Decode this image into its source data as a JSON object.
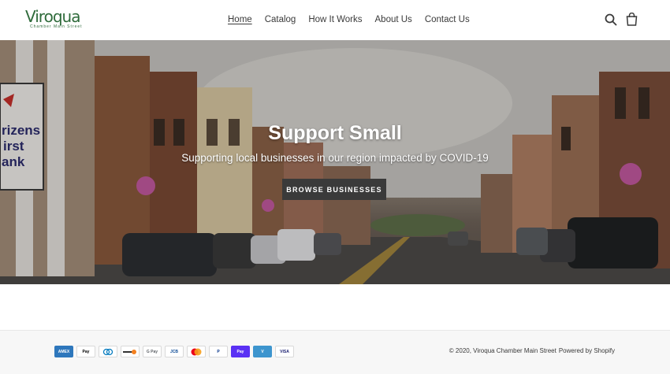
{
  "logo": {
    "name": "Viroqua",
    "tagline": "Chamber Main Street"
  },
  "nav": {
    "items": [
      {
        "label": "Home"
      },
      {
        "label": "Catalog"
      },
      {
        "label": "How It Works"
      },
      {
        "label": "About Us"
      },
      {
        "label": "Contact Us"
      }
    ]
  },
  "hero": {
    "title": "Support Small",
    "subtitle": "Supporting local businesses in our region impacted by COVID-19",
    "button_label": "BROWSE BUSINESSES",
    "sign_text": [
      "rizens",
      "irst",
      "ank"
    ]
  },
  "footer": {
    "payment_methods": [
      {
        "name": "American Express",
        "label": "AMEX",
        "bg": "#2e77bc",
        "fg": "#ffffff"
      },
      {
        "name": "Apple Pay",
        "label": "Pay",
        "bg": "#ffffff",
        "fg": "#000000"
      },
      {
        "name": "Diners Club",
        "label": "",
        "bg": "#ffffff",
        "fg": "#0079be"
      },
      {
        "name": "Discover",
        "label": "",
        "bg": "#ffffff",
        "fg": "#f48120"
      },
      {
        "name": "Google Pay",
        "label": "G Pay",
        "bg": "#ffffff",
        "fg": "#5f6368"
      },
      {
        "name": "JCB",
        "label": "JCB",
        "bg": "#ffffff",
        "fg": "#0e4c96"
      },
      {
        "name": "Mastercard",
        "label": "",
        "bg": "#ffffff",
        "fg": "#eb001b"
      },
      {
        "name": "PayPal",
        "label": "P",
        "bg": "#ffffff",
        "fg": "#003087"
      },
      {
        "name": "Shop Pay",
        "label": "Pay",
        "bg": "#5a31f4",
        "fg": "#ffffff"
      },
      {
        "name": "Venmo",
        "label": "V",
        "bg": "#3d95ce",
        "fg": "#ffffff"
      },
      {
        "name": "Visa",
        "label": "VISA",
        "bg": "#ffffff",
        "fg": "#1a1f71"
      }
    ],
    "copyright": "© 2020, Viroqua Chamber Main Street",
    "powered_by": "Powered by Shopify"
  },
  "colors": {
    "brand": "#2f6b3b",
    "button": "#3a3a3a",
    "text": "#3a3a3a"
  }
}
